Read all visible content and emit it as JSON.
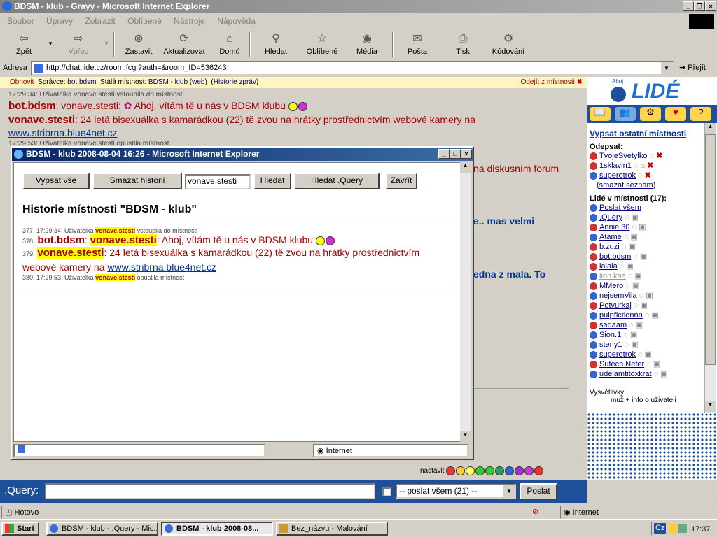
{
  "window": {
    "title": "BDSM - klub - Grayy - Microsoft Internet Explorer"
  },
  "menu": [
    "Soubor",
    "Úpravy",
    "Zobrazit",
    "Oblíbené",
    "Nástroje",
    "Nápověda"
  ],
  "toolbar": {
    "back": "Zpět",
    "forward": "Vpřed",
    "stop": "Zastavit",
    "refresh": "Aktualizovat",
    "home": "Domů",
    "search": "Hledat",
    "favorites": "Oblíbené",
    "media": "Média",
    "mail": "Pošta",
    "print": "Tisk",
    "encoding": "Kódování"
  },
  "address": {
    "label": "Adresa",
    "url": "http://chat.lide.cz/room.fcgi?auth=&room_ID=536243",
    "go": "Přejít"
  },
  "roombar": {
    "refresh": "Obnovit",
    "admin_label": "Správce:",
    "admin": "bot.bdsm",
    "room_label": "Stálá místnost:",
    "room": "BDSM - klub",
    "web": "web",
    "history": "Historie zpráv",
    "leave": "Odejít z místnosti"
  },
  "chat": {
    "line1": "17:29:34: Uživatelka vonave.stesti vstoupila do místnosti",
    "nick1": "bot.bdsm",
    "msg1": ": vonave.stesti: ",
    "msg1b": "Ahoj, vítám tě u nás v BDSM klubu",
    "nick2": "vonave.stesti",
    "msg2": ": 24 letá bisexuálka s kamarádkou (22) tě zvou na hrátky prostřednictvím webové kamery na",
    "link2": "www.stribrna.blue4net.cz",
    "line3": "17:29:53: Uživatelka vonave.stesti opustila místnost",
    "frag_a": "na diskusním forum",
    "frag_b": "e.. mas velmi",
    "frag_c": "edna z mala. To"
  },
  "popup": {
    "title": "BDSM - klub 2008-08-04 16:26 - Microsoft Internet Explorer",
    "btn_all": "Vypsat vše",
    "btn_clear": "Smazat historii",
    "search_value": "vonave.stesti",
    "btn_search": "Hledat",
    "btn_search_query": "Hledat .Query",
    "btn_close": "Zavřít",
    "heading": "Historie místnosti \"BDSM - klub\"",
    "e377_pre": "377. 17:29:34: Uživatelka ",
    "e377_hl": "vonave.stesti",
    "e377_post": " vstoupila do místnosti",
    "e378_num": "378.",
    "e378_nick": "bot.bdsm",
    "e378_colon": ": ",
    "e378_hl": "vonave.stesti",
    "e378_msg": ": Ahoj, vítám tě u nás v BDSM klubu",
    "e379_num": "379.",
    "e379_nick": "vonave.stesti",
    "e379_msg": ": 24 letá bisexuálka s kamarádkou (22) tě zvou na hrátky prostřednictvím webové kamery na ",
    "e379_link": "www.stribrna.blue4net.cz",
    "e380_pre": "380. 17:29:53: Uživatelka ",
    "e380_hl": "vonave.stesti",
    "e380_post": " opustila místnost",
    "status_zone": "Internet"
  },
  "sidebar": {
    "logo_small": "Ahoj...",
    "logo": "LIDÉ",
    "other_rooms": "Vypsat ostatní místnosti",
    "unsubscribe_head": "Odepsat:",
    "unsub": [
      "TvojeSvetylko",
      "1sklavin1",
      "superotrok"
    ],
    "clear_list": "smazat seznam",
    "people_head": "Lidé v místnosti (17):",
    "send_all": "Poslat všem",
    "people": [
      ".Query",
      "Annie.30",
      "Atame",
      "b.zuzi",
      "bot.bdsm",
      "lalala",
      "lion.kaa",
      "MMero",
      "nejsemVila",
      "Potvurkaj",
      "pulpfictionnn",
      "sadaam",
      "Sion.1",
      "steny1",
      "superotrok",
      "Sutech.Nefer",
      "udelamtitoxkrat"
    ],
    "legend_head": "Vysvětlivky:",
    "legend_1": "muž + info o uživateli"
  },
  "bottom": {
    "setup": "nastavit",
    "nick": ".Query:",
    "recipient": "-- poslat všem (21) --",
    "send": "Poslat"
  },
  "statusbar": {
    "left": "Hotovo",
    "zone": "Internet"
  },
  "taskbar": {
    "start": "Start",
    "tasks": [
      "BDSM - klub - .Query - Mic...",
      "BDSM - klub 2008-08...",
      "Bez_názvu - Malování"
    ],
    "lang": "Cz",
    "clock": "17:37"
  },
  "colors": {
    "chat_red": "#a00000",
    "link_blue": "#003399",
    "highlight": "#ffff00",
    "title_gray": "#808080"
  }
}
